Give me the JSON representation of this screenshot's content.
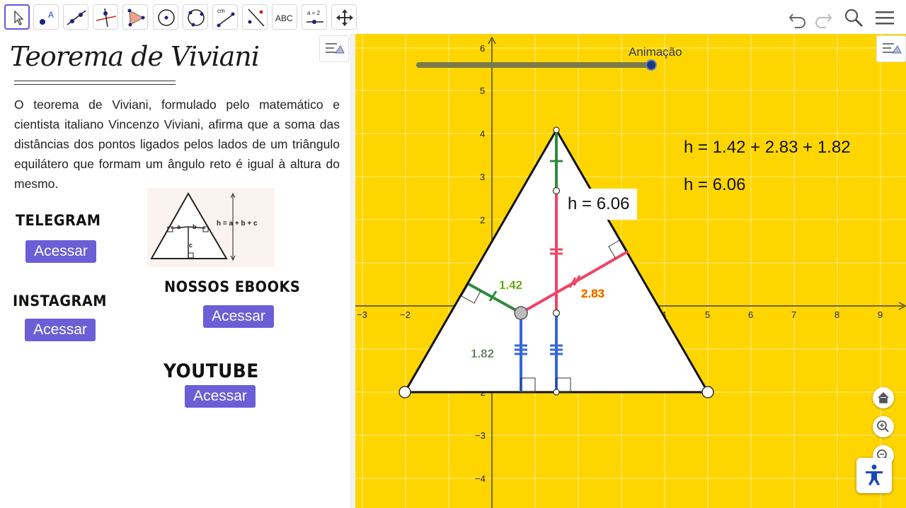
{
  "toolbar": {
    "tools": [
      "move",
      "point",
      "line",
      "perpendicular-line",
      "polygon",
      "circle",
      "conic",
      "distance",
      "reflect",
      "text",
      "slider",
      "move-graphics-view"
    ],
    "text_tool_label": "ABC",
    "slider_tool_label": "a = 2",
    "distance_tool_label": "cm"
  },
  "algebra": {
    "title": "Teorema de Viviani",
    "description": "O teorema  de Viviani, formulado  pelo matemático e cientista italiano Vincenzo Viviani,  afirma que a  soma das distâncias dos pontos ligados pelos lados  de  um triângulo equilátero que formam um ângulo reto é igual à altura do mesmo.",
    "diagram_labels": {
      "formula": "h = a + b + c",
      "a": "a",
      "b": "b",
      "c": "c"
    },
    "telegram": {
      "label": "TELEGRAM",
      "button": "Acessar"
    },
    "instagram": {
      "label": "INSTAGRAM",
      "button": "Acessar"
    },
    "ebooks": {
      "label": "NOSSOS EBOOKS",
      "button": "Acessar"
    },
    "youtube": {
      "label": "YOUTUBE",
      "button": "Acessar"
    }
  },
  "graphics": {
    "slider_label": "Animação",
    "slider_value": 1.0,
    "x_ticks": [
      "−3",
      "−2",
      "4",
      "5",
      "6",
      "7",
      "8",
      "9"
    ],
    "y_ticks": [
      "6",
      "5",
      "4",
      "3",
      "2",
      "−2",
      "−3",
      "−4"
    ],
    "sum_text": "h = 1.42 + 2.83 + 1.82",
    "h_text": "h = 6.06",
    "h_box_text": "h = 6.06",
    "label_a": "1.42",
    "label_b": "2.83",
    "label_c": "1.82"
  },
  "colors": {
    "background": "#ffd500",
    "green_segment": "#2e8b3e",
    "red_segment": "#ee4466",
    "blue_segment": "#3366dd",
    "accent_button": "#6b5ed6"
  }
}
